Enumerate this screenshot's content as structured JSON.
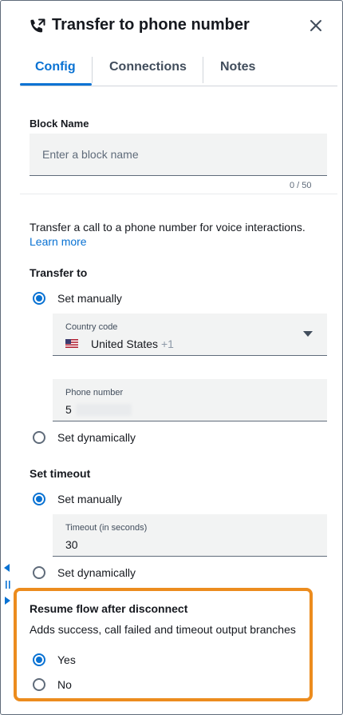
{
  "header": {
    "title": "Transfer to phone number",
    "icon": "phone-transfer-icon",
    "close_icon": "close-icon"
  },
  "tabs": [
    {
      "label": "Config",
      "active": true
    },
    {
      "label": "Connections",
      "active": false
    },
    {
      "label": "Notes",
      "active": false
    }
  ],
  "block_name": {
    "label": "Block Name",
    "placeholder": "Enter a block name",
    "counter": "0 / 50"
  },
  "description": {
    "text": "Transfer a call to a phone number for voice interactions.",
    "link": "Learn more"
  },
  "transfer_to": {
    "title": "Transfer to",
    "options": [
      {
        "label": "Set manually",
        "selected": true
      },
      {
        "label": "Set dynamically",
        "selected": false
      }
    ],
    "country_code": {
      "label": "Country code",
      "value": "United States",
      "dial_code": "+1",
      "flag_icon": "us-flag-icon"
    },
    "phone_number": {
      "label": "Phone number",
      "value": "5"
    }
  },
  "timeout": {
    "title": "Set timeout",
    "options": [
      {
        "label": "Set manually",
        "selected": true
      },
      {
        "label": "Set dynamically",
        "selected": false
      }
    ],
    "field": {
      "label": "Timeout (in seconds)",
      "value": "30"
    }
  },
  "resume": {
    "title": "Resume flow after disconnect",
    "description": "Adds success, call failed and timeout output branches",
    "options": [
      {
        "label": "Yes",
        "selected": true
      },
      {
        "label": "No",
        "selected": false
      }
    ]
  },
  "colors": {
    "accent": "#0972d3",
    "highlight": "#ec8c1e",
    "text": "#16191f"
  }
}
